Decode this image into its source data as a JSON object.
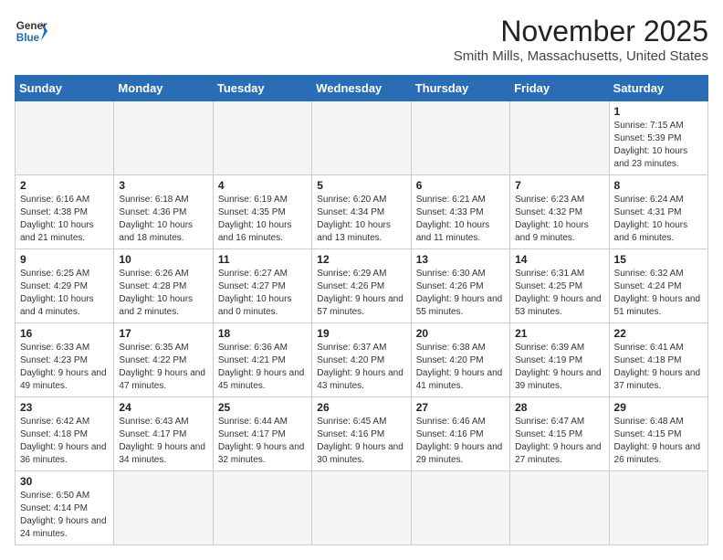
{
  "header": {
    "logo_line1": "General",
    "logo_line2": "Blue",
    "month": "November 2025",
    "location": "Smith Mills, Massachusetts, United States"
  },
  "weekdays": [
    "Sunday",
    "Monday",
    "Tuesday",
    "Wednesday",
    "Thursday",
    "Friday",
    "Saturday"
  ],
  "weeks": [
    [
      {
        "day": "",
        "info": ""
      },
      {
        "day": "",
        "info": ""
      },
      {
        "day": "",
        "info": ""
      },
      {
        "day": "",
        "info": ""
      },
      {
        "day": "",
        "info": ""
      },
      {
        "day": "",
        "info": ""
      },
      {
        "day": "1",
        "info": "Sunrise: 7:15 AM\nSunset: 5:39 PM\nDaylight: 10 hours and 23 minutes."
      }
    ],
    [
      {
        "day": "2",
        "info": "Sunrise: 6:16 AM\nSunset: 4:38 PM\nDaylight: 10 hours and 21 minutes."
      },
      {
        "day": "3",
        "info": "Sunrise: 6:18 AM\nSunset: 4:36 PM\nDaylight: 10 hours and 18 minutes."
      },
      {
        "day": "4",
        "info": "Sunrise: 6:19 AM\nSunset: 4:35 PM\nDaylight: 10 hours and 16 minutes."
      },
      {
        "day": "5",
        "info": "Sunrise: 6:20 AM\nSunset: 4:34 PM\nDaylight: 10 hours and 13 minutes."
      },
      {
        "day": "6",
        "info": "Sunrise: 6:21 AM\nSunset: 4:33 PM\nDaylight: 10 hours and 11 minutes."
      },
      {
        "day": "7",
        "info": "Sunrise: 6:23 AM\nSunset: 4:32 PM\nDaylight: 10 hours and 9 minutes."
      },
      {
        "day": "8",
        "info": "Sunrise: 6:24 AM\nSunset: 4:31 PM\nDaylight: 10 hours and 6 minutes."
      }
    ],
    [
      {
        "day": "9",
        "info": "Sunrise: 6:25 AM\nSunset: 4:29 PM\nDaylight: 10 hours and 4 minutes."
      },
      {
        "day": "10",
        "info": "Sunrise: 6:26 AM\nSunset: 4:28 PM\nDaylight: 10 hours and 2 minutes."
      },
      {
        "day": "11",
        "info": "Sunrise: 6:27 AM\nSunset: 4:27 PM\nDaylight: 10 hours and 0 minutes."
      },
      {
        "day": "12",
        "info": "Sunrise: 6:29 AM\nSunset: 4:26 PM\nDaylight: 9 hours and 57 minutes."
      },
      {
        "day": "13",
        "info": "Sunrise: 6:30 AM\nSunset: 4:26 PM\nDaylight: 9 hours and 55 minutes."
      },
      {
        "day": "14",
        "info": "Sunrise: 6:31 AM\nSunset: 4:25 PM\nDaylight: 9 hours and 53 minutes."
      },
      {
        "day": "15",
        "info": "Sunrise: 6:32 AM\nSunset: 4:24 PM\nDaylight: 9 hours and 51 minutes."
      }
    ],
    [
      {
        "day": "16",
        "info": "Sunrise: 6:33 AM\nSunset: 4:23 PM\nDaylight: 9 hours and 49 minutes."
      },
      {
        "day": "17",
        "info": "Sunrise: 6:35 AM\nSunset: 4:22 PM\nDaylight: 9 hours and 47 minutes."
      },
      {
        "day": "18",
        "info": "Sunrise: 6:36 AM\nSunset: 4:21 PM\nDaylight: 9 hours and 45 minutes."
      },
      {
        "day": "19",
        "info": "Sunrise: 6:37 AM\nSunset: 4:20 PM\nDaylight: 9 hours and 43 minutes."
      },
      {
        "day": "20",
        "info": "Sunrise: 6:38 AM\nSunset: 4:20 PM\nDaylight: 9 hours and 41 minutes."
      },
      {
        "day": "21",
        "info": "Sunrise: 6:39 AM\nSunset: 4:19 PM\nDaylight: 9 hours and 39 minutes."
      },
      {
        "day": "22",
        "info": "Sunrise: 6:41 AM\nSunset: 4:18 PM\nDaylight: 9 hours and 37 minutes."
      }
    ],
    [
      {
        "day": "23",
        "info": "Sunrise: 6:42 AM\nSunset: 4:18 PM\nDaylight: 9 hours and 36 minutes."
      },
      {
        "day": "24",
        "info": "Sunrise: 6:43 AM\nSunset: 4:17 PM\nDaylight: 9 hours and 34 minutes."
      },
      {
        "day": "25",
        "info": "Sunrise: 6:44 AM\nSunset: 4:17 PM\nDaylight: 9 hours and 32 minutes."
      },
      {
        "day": "26",
        "info": "Sunrise: 6:45 AM\nSunset: 4:16 PM\nDaylight: 9 hours and 30 minutes."
      },
      {
        "day": "27",
        "info": "Sunrise: 6:46 AM\nSunset: 4:16 PM\nDaylight: 9 hours and 29 minutes."
      },
      {
        "day": "28",
        "info": "Sunrise: 6:47 AM\nSunset: 4:15 PM\nDaylight: 9 hours and 27 minutes."
      },
      {
        "day": "29",
        "info": "Sunrise: 6:48 AM\nSunset: 4:15 PM\nDaylight: 9 hours and 26 minutes."
      }
    ],
    [
      {
        "day": "30",
        "info": "Sunrise: 6:50 AM\nSunset: 4:14 PM\nDaylight: 9 hours and 24 minutes."
      },
      {
        "day": "",
        "info": ""
      },
      {
        "day": "",
        "info": ""
      },
      {
        "day": "",
        "info": ""
      },
      {
        "day": "",
        "info": ""
      },
      {
        "day": "",
        "info": ""
      },
      {
        "day": "",
        "info": ""
      }
    ]
  ]
}
